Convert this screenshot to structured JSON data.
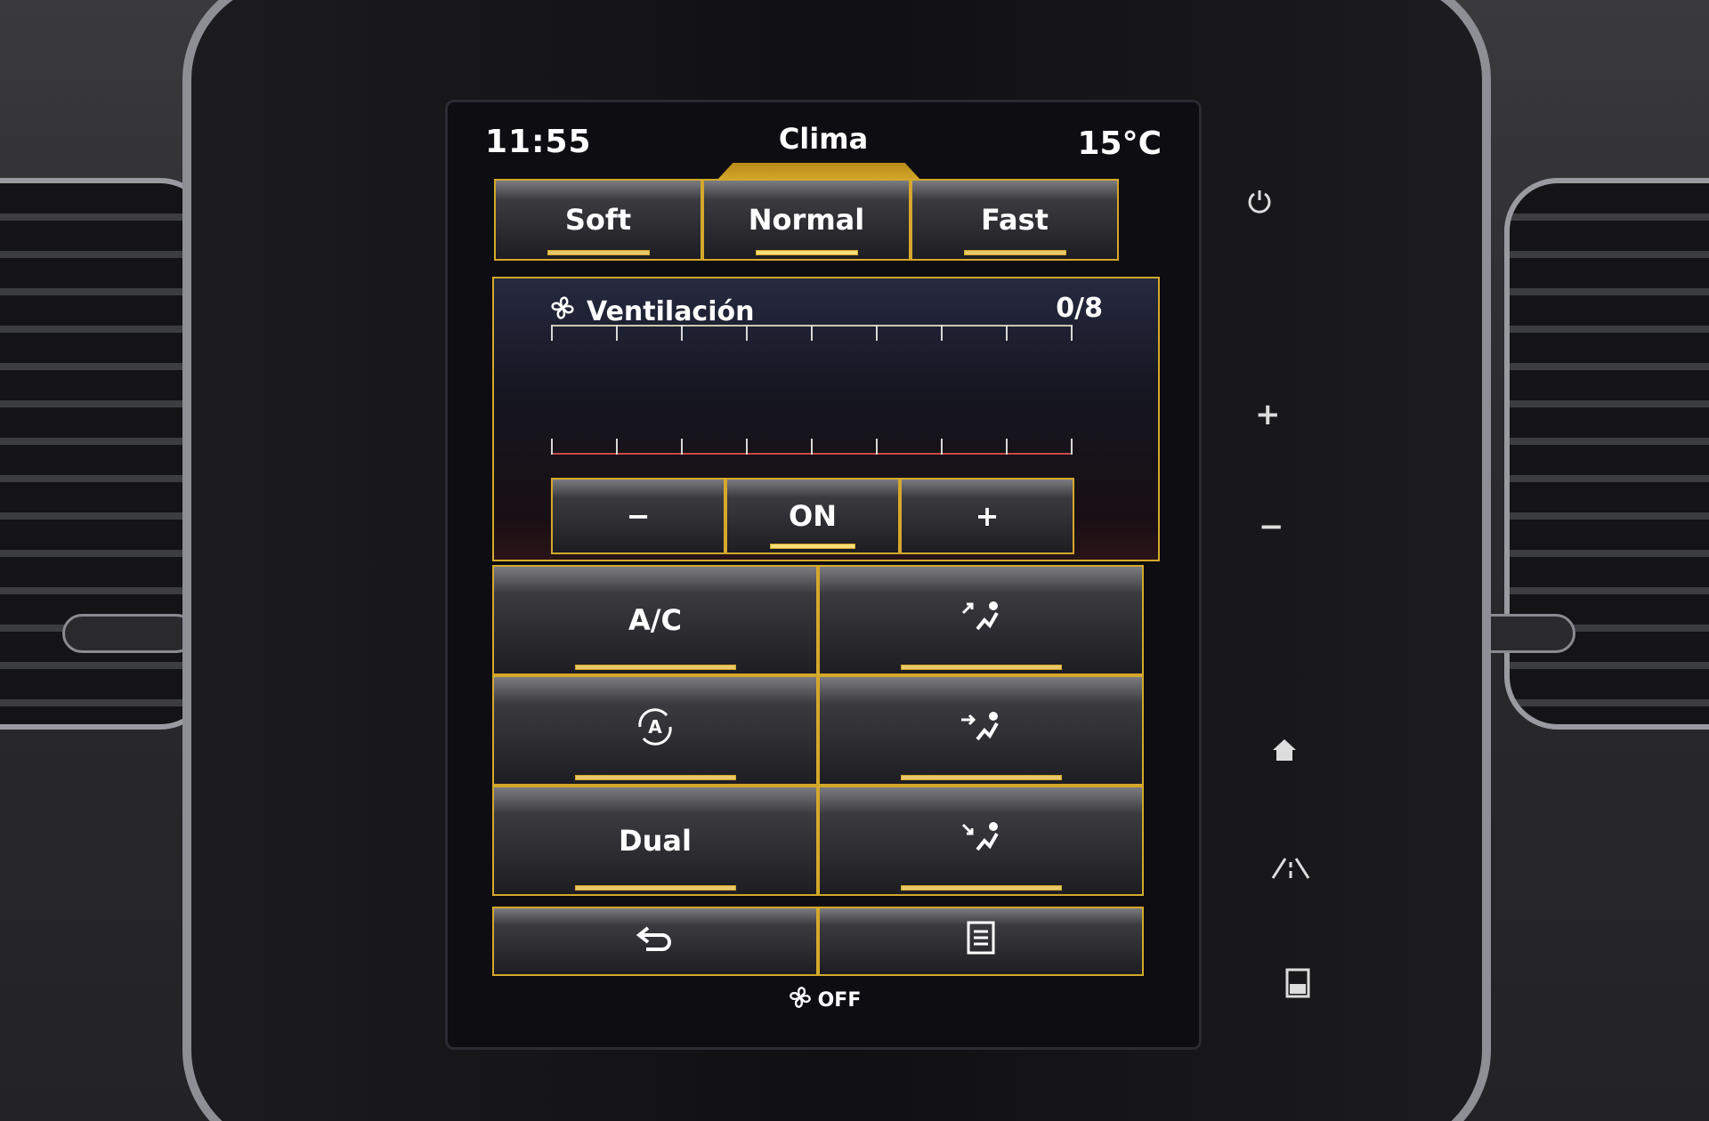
{
  "status": {
    "time": "11:55",
    "title": "Clima",
    "outside_temp": "15°C"
  },
  "modes": [
    {
      "label": "Soft",
      "selected": false
    },
    {
      "label": "Normal",
      "selected": true
    },
    {
      "label": "Fast",
      "selected": false
    }
  ],
  "ventilation": {
    "label": "Ventilación",
    "level_text": "0/8",
    "level": 0,
    "max": 8,
    "minus_label": "−",
    "on_label": "ON",
    "plus_label": "+"
  },
  "controls": {
    "ac_label": "A/C",
    "dual_label": "Dual"
  },
  "footer": {
    "fan_off_label": "OFF"
  },
  "colors": {
    "accent": "#d4a82a",
    "scale_bottom": "#c94848"
  },
  "icons": {
    "recirculation": "recirculation-icon",
    "airflow_up": "airflow-up-icon",
    "airflow_face": "airflow-face-icon",
    "airflow_down": "airflow-down-icon",
    "back": "back-icon",
    "menu": "menu-icon",
    "power": "power-icon",
    "home": "home-icon",
    "driving": "driving-assist-icon",
    "display": "display-icon"
  }
}
